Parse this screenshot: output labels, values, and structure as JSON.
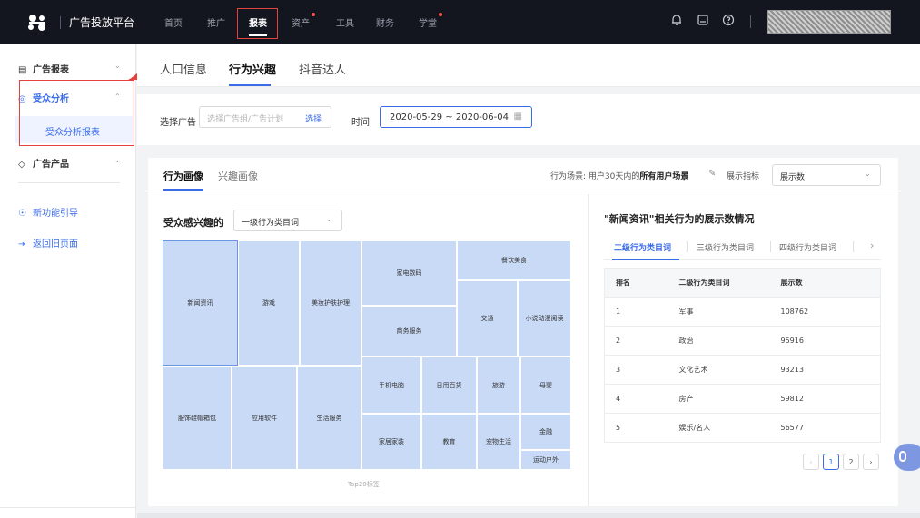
{
  "topbar": {
    "brand": "广告投放平台",
    "nav": [
      {
        "label": "首页"
      },
      {
        "label": "推广"
      },
      {
        "label": "报表"
      },
      {
        "label": "资产"
      },
      {
        "label": "工具"
      },
      {
        "label": "财务"
      },
      {
        "label": "学堂"
      }
    ],
    "active_nav": "报表",
    "icons": [
      "bell-icon",
      "save-icon",
      "help-icon"
    ]
  },
  "sidebar": {
    "items": [
      {
        "label": "广告报表"
      },
      {
        "label": "受众分析"
      },
      {
        "label": "受众分析报表"
      },
      {
        "label": "广告产品"
      },
      {
        "label": "新功能引导"
      },
      {
        "label": "返回旧页面"
      }
    ]
  },
  "subtabs": [
    {
      "label": "人口信息"
    },
    {
      "label": "行为兴趣"
    },
    {
      "label": "抖音达人"
    }
  ],
  "filters": {
    "ad_label": "选择广告",
    "ad_placeholder": "选择广告组/广告计划",
    "ad_select": "选择",
    "time_label": "时间",
    "date_range": "2020-05-29 ~ 2020-06-04"
  },
  "profile": {
    "tabs": [
      {
        "label": "行为画像"
      },
      {
        "label": "兴趣画像"
      }
    ],
    "scene_prefix": "行为场景: 用户30天内的",
    "scene_bold": "所有用户场景",
    "metric_label": "展示指标",
    "metric_value": "展示数",
    "interest_title": "受众感兴趣的",
    "category_select": "一级行为类目词",
    "treemap_caption": "Top20标签",
    "treemap": [
      {
        "label": "新闻资讯"
      },
      {
        "label": "游戏"
      },
      {
        "label": "美妆护肤护理"
      },
      {
        "label": "家电数码"
      },
      {
        "label": "餐饮美食"
      },
      {
        "label": "商务服务"
      },
      {
        "label": "交通"
      },
      {
        "label": "小说动漫阅读"
      },
      {
        "label": "服饰鞋帽箱包"
      },
      {
        "label": "应用软件"
      },
      {
        "label": "生活服务"
      },
      {
        "label": "手机电脑"
      },
      {
        "label": "日用百货"
      },
      {
        "label": "旅游"
      },
      {
        "label": "母婴"
      },
      {
        "label": "家居家装"
      },
      {
        "label": "教育"
      },
      {
        "label": "宠物生活"
      },
      {
        "label": "金融"
      },
      {
        "label": "运动户外"
      }
    ]
  },
  "right_panel": {
    "title": "\"新闻资讯\"相关行为的展示数情况",
    "tabs": [
      {
        "label": "二级行为类目词"
      },
      {
        "label": "三级行为类目词"
      },
      {
        "label": "四级行为类目词"
      }
    ],
    "columns": [
      "排名",
      "二级行为类目词",
      "展示数"
    ],
    "rows": [
      [
        "1",
        "军事",
        "108762"
      ],
      [
        "2",
        "政治",
        "95916"
      ],
      [
        "3",
        "文化艺术",
        "93213"
      ],
      [
        "4",
        "房产",
        "59812"
      ],
      [
        "5",
        "娱乐/名人",
        "56577"
      ]
    ],
    "pagination": {
      "pages": [
        "1",
        "2"
      ],
      "current": "1"
    }
  }
}
